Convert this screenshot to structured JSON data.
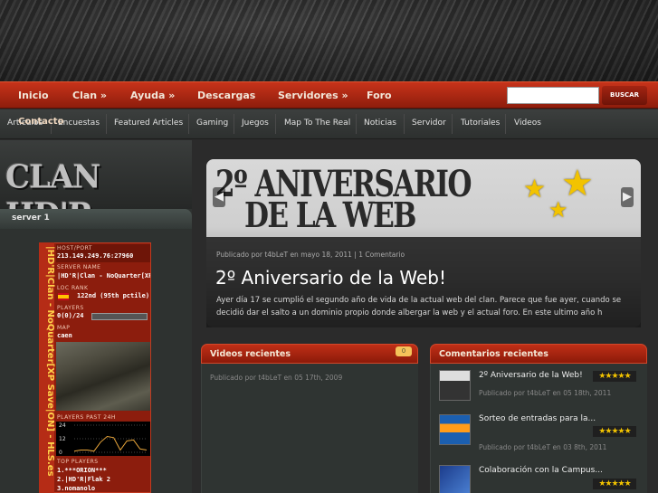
{
  "nav": {
    "items": [
      "Inicio",
      "Clan »",
      "Ayuda »",
      "Descargas",
      "Servidores »",
      "Foro"
    ],
    "search_button": "BUSCAR",
    "contact": "Contacto"
  },
  "categories": [
    "Articulos",
    "Encuestas",
    "Featured Articles",
    "Gaming",
    "Juegos",
    "Map To The Real",
    "Noticias",
    "Servidor",
    "Tutoriales",
    "Videos"
  ],
  "sidebar": {
    "logo_text": "CLAN HD'R",
    "server_title": "server 1",
    "banner": {
      "vertical_text": "|HD'R|Clan - NoQuarter[XP Save|ON] - HLS.es",
      "host_label": "HOST/PORT",
      "host_value": "213.149.249.76:27960",
      "name_label": "SERVER NAME",
      "name_value": "|HD'R|Clan - NoQuarter[XP",
      "loc_label": "LOC RANK",
      "loc_value": "122nd (95th pctile)",
      "players_label": "PLAYERS",
      "players_value": "0(0)/24",
      "map_label": "MAP",
      "map_value": "caen",
      "graph_label": "PLAYERS PAST 24H",
      "graph_ticks": [
        "24",
        "12",
        "0"
      ],
      "graph_values": [
        1,
        2,
        2,
        1,
        9,
        14,
        13,
        2,
        10,
        11,
        3,
        2
      ],
      "top_label": "TOP PLAYERS",
      "top_players": [
        "1.***ORION***",
        "2.|HD'R|Flak 2",
        "3.nomanolo"
      ]
    }
  },
  "slider": {
    "image_line1": "2º ANIVERSARIO",
    "image_line2": "DE LA WEB",
    "meta": "Publicado por t4bLeT en mayo 18, 2011 | 1 Comentario",
    "title": "2º Aniversario de la Web!",
    "text": "Ayer día 17 se cumplió el segundo año de vida de la actual web del clan. Parece que fue ayer, cuando se decidió dar el salto a un dominio propio donde albergar la web y el actual foro. En este ultimo año h"
  },
  "videos": {
    "title": "Videos recientes",
    "meta": "Publicado por t4bLeT en 05 17th, 2009",
    "bubble": "0"
  },
  "comments": {
    "title": "Comentarios recientes",
    "items": [
      {
        "title": "2º Aniversario de la Web!",
        "meta": "Publicado por t4bLeT en 05 18th, 2011",
        "stars": "★★★★★"
      },
      {
        "title": "Sorteo de entradas para la...",
        "meta": "Publicado por t4bLeT en 03 8th, 2011",
        "stars": "★★★★★"
      },
      {
        "title": "Colaboración con la Campus...",
        "meta": "",
        "stars": "★★★★★"
      }
    ]
  }
}
